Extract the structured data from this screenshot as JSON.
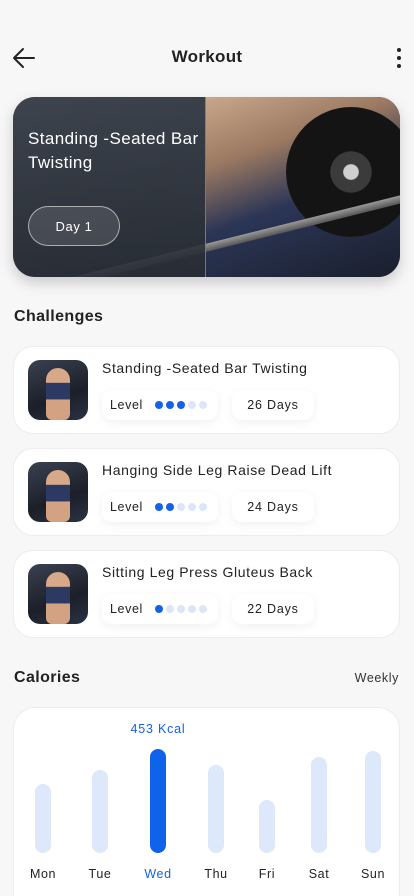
{
  "header": {
    "title": "Workout",
    "back_icon": "arrow-left-icon",
    "menu_icon": "more-vertical-icon"
  },
  "hero": {
    "title": "Standing -Seated Bar Twisting",
    "day_label": "Day 1"
  },
  "challenges": {
    "title": "Challenges",
    "items": [
      {
        "name": "Standing -Seated Bar Twisting",
        "level_label": "Level",
        "level": 3,
        "level_max": 5,
        "days": "26 Days"
      },
      {
        "name": "Hanging Side Leg Raise Dead Lift",
        "level_label": "Level",
        "level": 2,
        "level_max": 5,
        "days": "24 Days"
      },
      {
        "name": "Sitting Leg Press Gluteus Back",
        "level_label": "Level",
        "level": 1,
        "level_max": 5,
        "days": "22 Days"
      }
    ]
  },
  "calories": {
    "title": "Calories",
    "period": "Weekly"
  },
  "colors": {
    "accent": "#1561e8",
    "bar_inactive": "#dde8fb",
    "background": "#f7f7f8"
  },
  "chart_data": {
    "type": "bar",
    "categories": [
      "Mon",
      "Tue",
      "Wed",
      "Thu",
      "Fri",
      "Sat",
      "Sun"
    ],
    "values": [
      300,
      360,
      453,
      385,
      230,
      420,
      445
    ],
    "highlighted": "Wed",
    "highlight_label": "453 Kcal",
    "ylim": [
      0,
      453
    ],
    "grid": false
  }
}
